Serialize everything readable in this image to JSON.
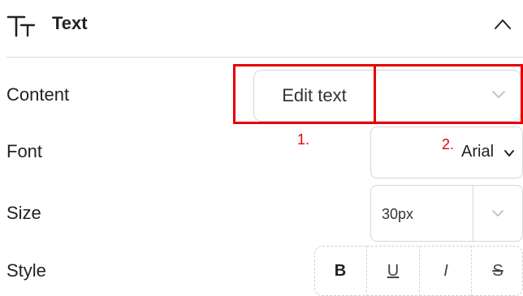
{
  "section": {
    "title": "Text",
    "icon": "text-format-icon",
    "collapse_icon": "chevron-up-icon"
  },
  "rows": {
    "content": {
      "label": "Content",
      "edit_button": "Edit text"
    },
    "font": {
      "label": "Font",
      "value": "Arial"
    },
    "size": {
      "label": "Size",
      "value": "30px"
    },
    "style": {
      "label": "Style",
      "bold": "B",
      "underline": "U",
      "italic": "I",
      "strikethrough": "S"
    }
  },
  "annotations": {
    "one": "1.",
    "two": "2."
  },
  "colors": {
    "annotation": "#e60000",
    "border": "#d6d6d6"
  }
}
